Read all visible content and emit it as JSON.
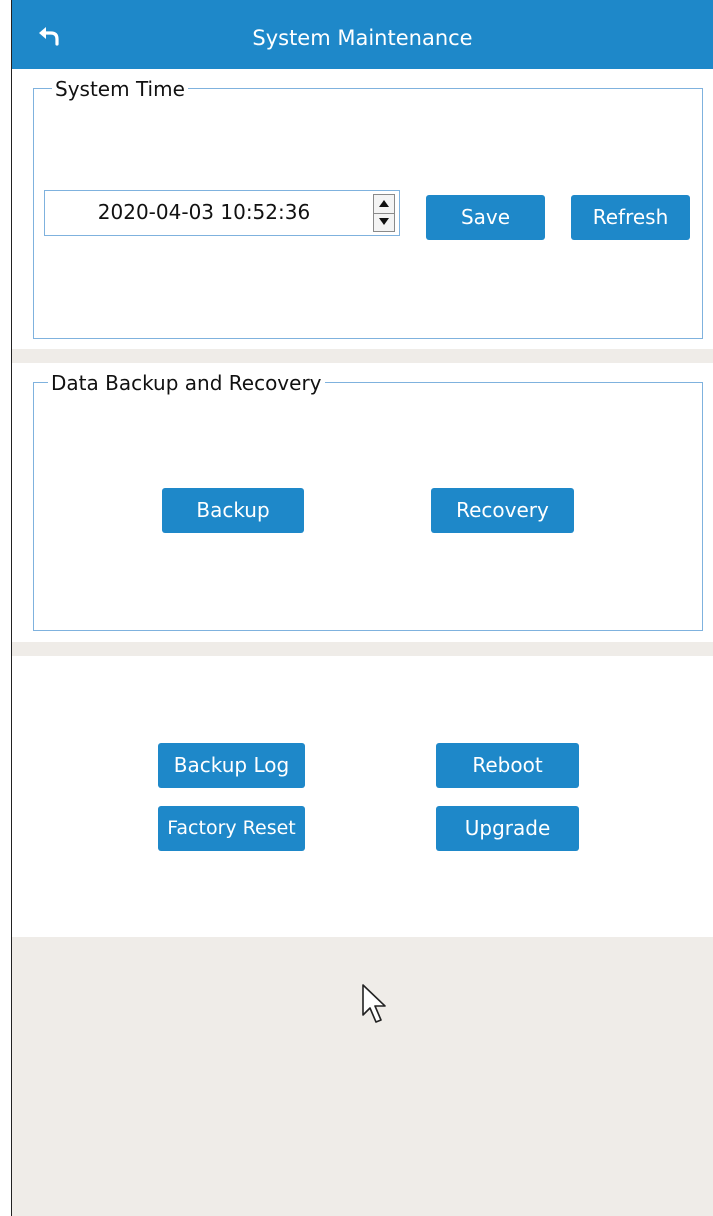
{
  "header": {
    "back_icon": "back-arrow-icon",
    "title": "System Maintenance"
  },
  "system_time": {
    "legend": "System Time",
    "datetime_value": "2020-04-03 10:52:36",
    "save_label": "Save",
    "refresh_label": "Refresh"
  },
  "backup_recovery": {
    "legend": "Data Backup and Recovery",
    "backup_label": "Backup",
    "recovery_label": "Recovery"
  },
  "actions": {
    "backup_log_label": "Backup Log",
    "reboot_label": "Reboot",
    "factory_reset_label": "Factory Reset",
    "upgrade_label": "Upgrade"
  },
  "colors": {
    "accent": "#1e88c9",
    "border": "#7fb2de",
    "separator": "#efece8"
  }
}
